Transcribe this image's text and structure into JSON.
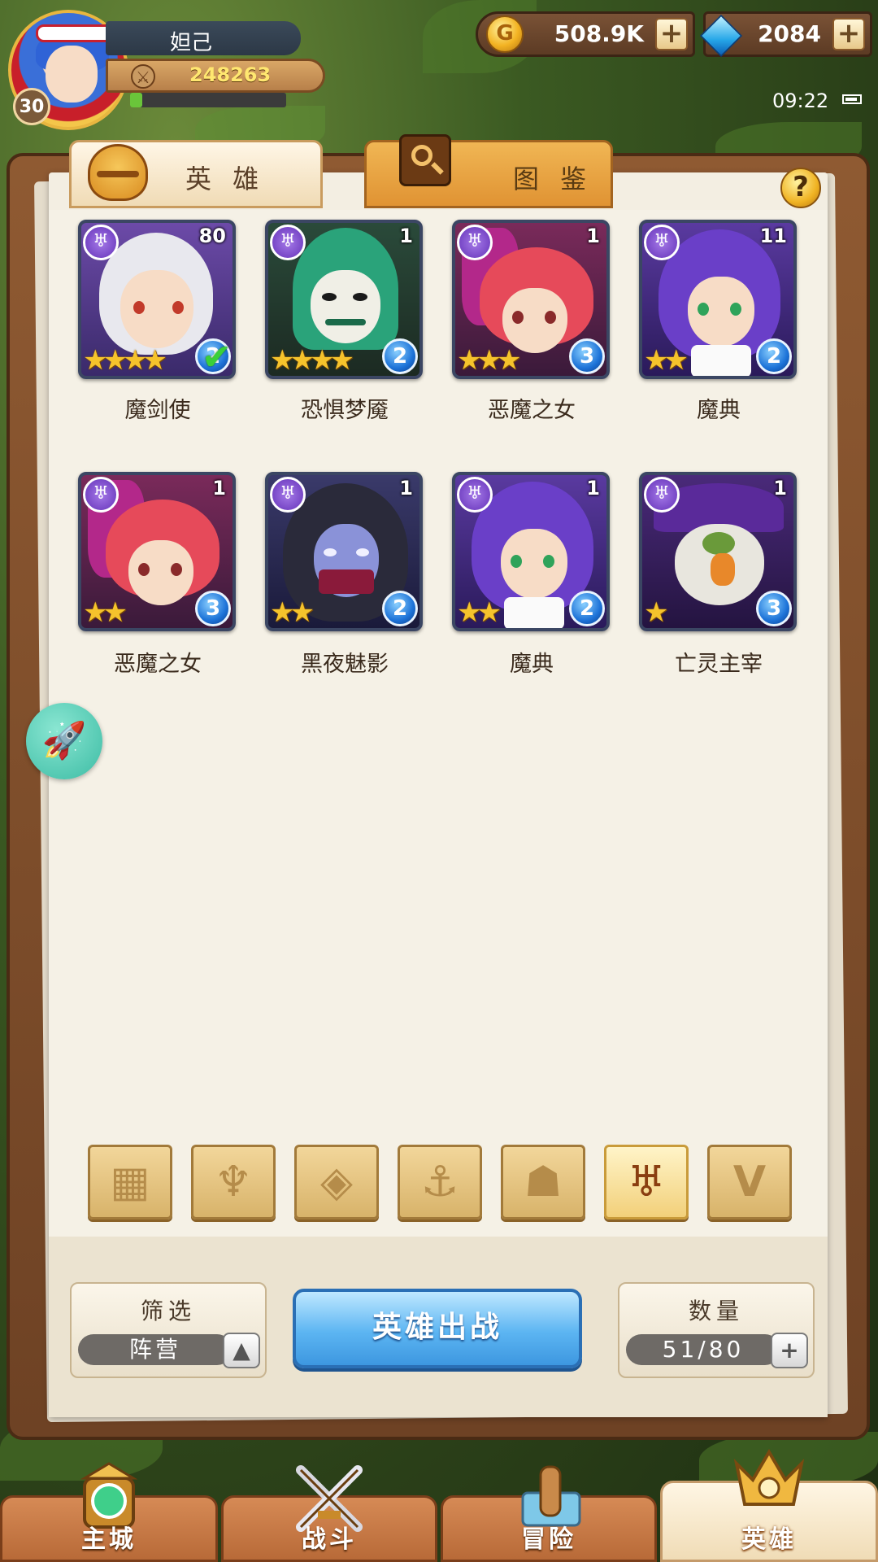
{
  "player": {
    "name": "妲己",
    "level": "30",
    "power": "248263",
    "exp_fraction": 0.08
  },
  "resources": {
    "gold": "508.9K",
    "gems": "2084",
    "plus": "+"
  },
  "status": {
    "time": "09:22"
  },
  "tabs": {
    "heroes": "英 雄",
    "album": "图 鉴"
  },
  "help": "?",
  "heroes": [
    {
      "name": "魔剑使",
      "level": "80",
      "stars": "★★★★",
      "grade": "2",
      "deployed": true
    },
    {
      "name": "恐惧梦魇",
      "level": "1",
      "stars": "★★★★",
      "grade": "2",
      "deployed": false
    },
    {
      "name": "恶魔之女",
      "level": "1",
      "stars": "★★★",
      "grade": "3",
      "deployed": false
    },
    {
      "name": "魔典",
      "level": "11",
      "stars": "★★",
      "grade": "2",
      "deployed": false
    },
    {
      "name": "恶魔之女",
      "level": "1",
      "stars": "★★",
      "grade": "3",
      "deployed": false
    },
    {
      "name": "黑夜魅影",
      "level": "1",
      "stars": "★★",
      "grade": "2",
      "deployed": false
    },
    {
      "name": "魔典",
      "level": "1",
      "stars": "★★",
      "grade": "2",
      "deployed": false
    },
    {
      "name": "亡灵主宰",
      "level": "1",
      "stars": "★",
      "grade": "3",
      "deployed": false
    }
  ],
  "filters": [
    {
      "icon": "grid-icon",
      "glyph": "▦",
      "active": false
    },
    {
      "icon": "leaf-faction-icon",
      "glyph": "♆",
      "active": false
    },
    {
      "icon": "diamond-faction-icon",
      "glyph": "◈",
      "active": false
    },
    {
      "icon": "anchor-faction-icon",
      "glyph": "⚓",
      "active": false
    },
    {
      "icon": "beast-faction-icon",
      "glyph": "☗",
      "active": false
    },
    {
      "icon": "demon-faction-icon",
      "glyph": "♅",
      "active": true
    },
    {
      "icon": "wing-faction-icon",
      "glyph": "V",
      "active": false
    }
  ],
  "controls": {
    "filter_title": "筛选",
    "filter_value": "阵营",
    "deploy": "英雄出战",
    "count_title": "数量",
    "count_value": "51/80"
  },
  "nav": {
    "main_city": "主城",
    "battle": "战斗",
    "adventure": "冒险",
    "heroes": "英雄"
  },
  "colors": {
    "accent": "#5cb5f2",
    "faction_purple": "#6431b8",
    "star_gold": "#f5c32c"
  }
}
